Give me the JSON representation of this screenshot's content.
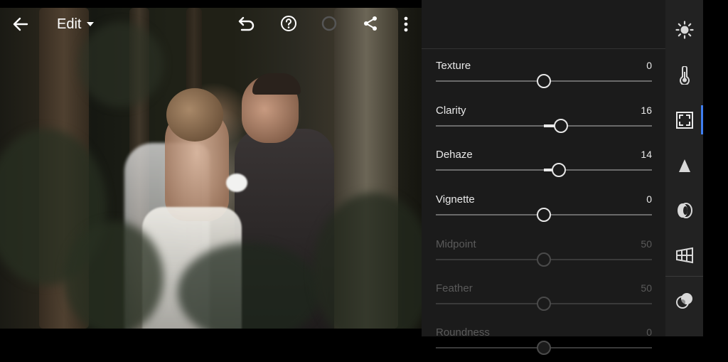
{
  "toolbar": {
    "edit_label": "Edit"
  },
  "icons": {
    "back": "back-arrow-icon",
    "caret": "chevron-down-icon",
    "undo": "undo-icon",
    "help": "help-icon",
    "progress": "sync-progress-icon",
    "share": "share-icon",
    "more": "more-vertical-icon"
  },
  "effects_panel": {
    "sliders": [
      {
        "label": "Texture",
        "value": "0",
        "amount": 0,
        "enabled": true
      },
      {
        "label": "Clarity",
        "value": "16",
        "amount": 16,
        "enabled": true
      },
      {
        "label": "Dehaze",
        "value": "14",
        "amount": 14,
        "enabled": true
      },
      {
        "label": "Vignette",
        "value": "0",
        "amount": 0,
        "enabled": true
      },
      {
        "label": "Midpoint",
        "value": "50",
        "amount": 0,
        "enabled": false
      },
      {
        "label": "Feather",
        "value": "50",
        "amount": 0,
        "enabled": false
      },
      {
        "label": "Roundness",
        "value": "0",
        "amount": 0,
        "enabled": false
      }
    ]
  },
  "tool_rail": {
    "items": [
      {
        "name": "light-icon"
      },
      {
        "name": "color-thermometer-icon"
      },
      {
        "name": "effects-frame-icon",
        "active": true
      },
      {
        "name": "detail-triangle-icon"
      },
      {
        "name": "optics-lens-icon"
      },
      {
        "name": "geometry-grid-icon"
      },
      {
        "name": "presets-circles-icon"
      }
    ]
  },
  "colors": {
    "panel_bg": "#1b1b1b",
    "rail_bg": "#222222",
    "accent": "#3f7ef0",
    "text": "#e8e8e8",
    "disabled_text": "#5a5a5a"
  }
}
